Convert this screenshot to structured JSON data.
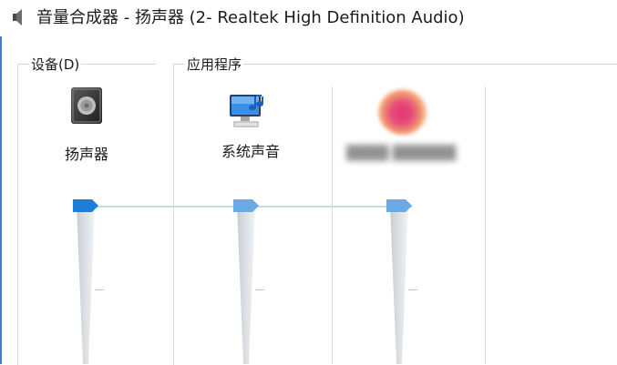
{
  "window": {
    "title": "音量合成器 - 扬声器 (2- Realtek High Definition Audio)",
    "icon": "speaker-icon"
  },
  "groups": {
    "device": {
      "label": "设备(D)"
    },
    "applications": {
      "label": "应用程序"
    }
  },
  "mixers": [
    {
      "label": "扬声器",
      "icon": "speaker-device-icon",
      "volume_percent": 100
    },
    {
      "label": "系统声音",
      "icon": "system-sounds-icon",
      "volume_percent": 100
    },
    {
      "label": "",
      "icon": "blurred-app-icon",
      "volume_percent": 100
    }
  ],
  "colors": {
    "thumb_active": "#1c7ed6",
    "thumb_muted": "#6aabe6"
  }
}
